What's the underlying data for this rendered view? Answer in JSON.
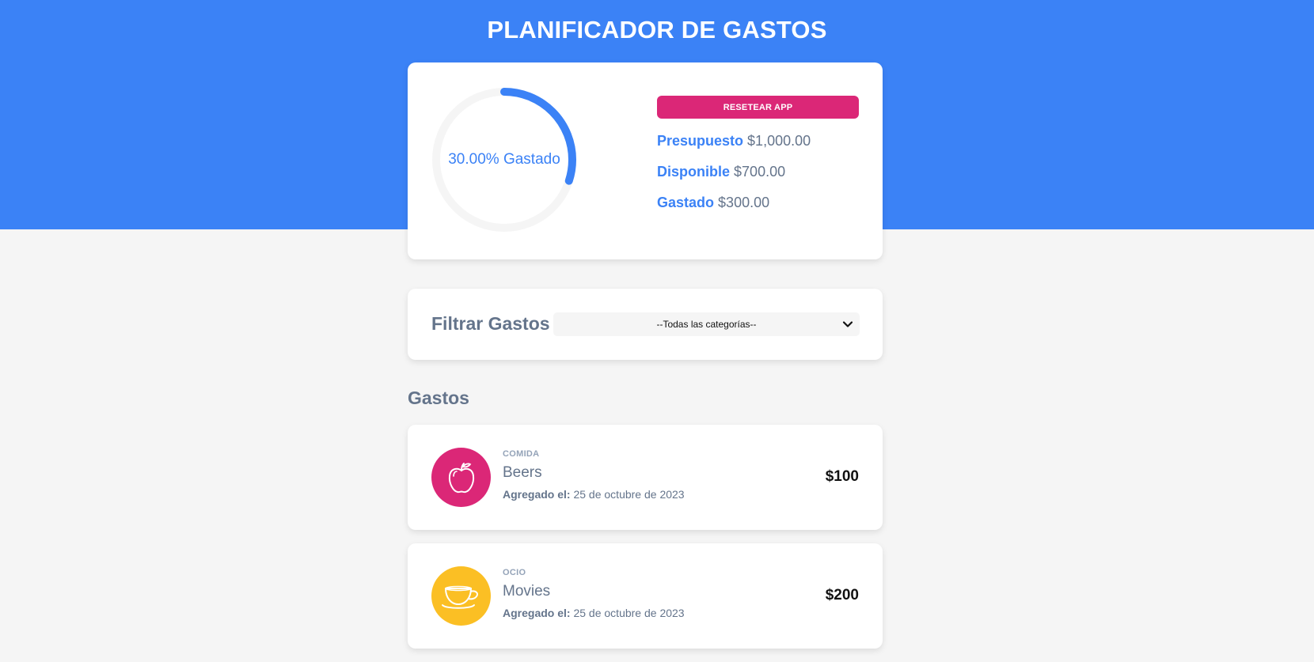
{
  "header": {
    "title": "PLANIFICADOR DE GASTOS"
  },
  "budget": {
    "progress_text": "30.00% Gastado",
    "progress_fraction": 0.3,
    "reset_label": "RESETEAR APP",
    "stats": [
      {
        "label": "Presupuesto",
        "value": "$1,000.00"
      },
      {
        "label": "Disponible",
        "value": "$700.00"
      },
      {
        "label": "Gastado",
        "value": "$300.00"
      }
    ]
  },
  "filter": {
    "label": "Filtrar Gastos",
    "selected": "--Todas las categorías--"
  },
  "expenses": {
    "title": "Gastos",
    "items": [
      {
        "category": "COMIDA",
        "name": "Beers",
        "date_label": "Agregado el:",
        "date": "25 de octubre de 2023",
        "amount": "$100",
        "icon": "apple-icon",
        "icon_color": "#db2777"
      },
      {
        "category": "OCIO",
        "name": "Movies",
        "date_label": "Agregado el:",
        "date": "25 de octubre de 2023",
        "amount": "$200",
        "icon": "teacup-icon",
        "icon_color": "#fbbf24"
      }
    ]
  },
  "colors": {
    "primary": "#3b82f6",
    "accent": "#db2777",
    "track": "#f5f5f5",
    "text_muted": "#64748b"
  }
}
